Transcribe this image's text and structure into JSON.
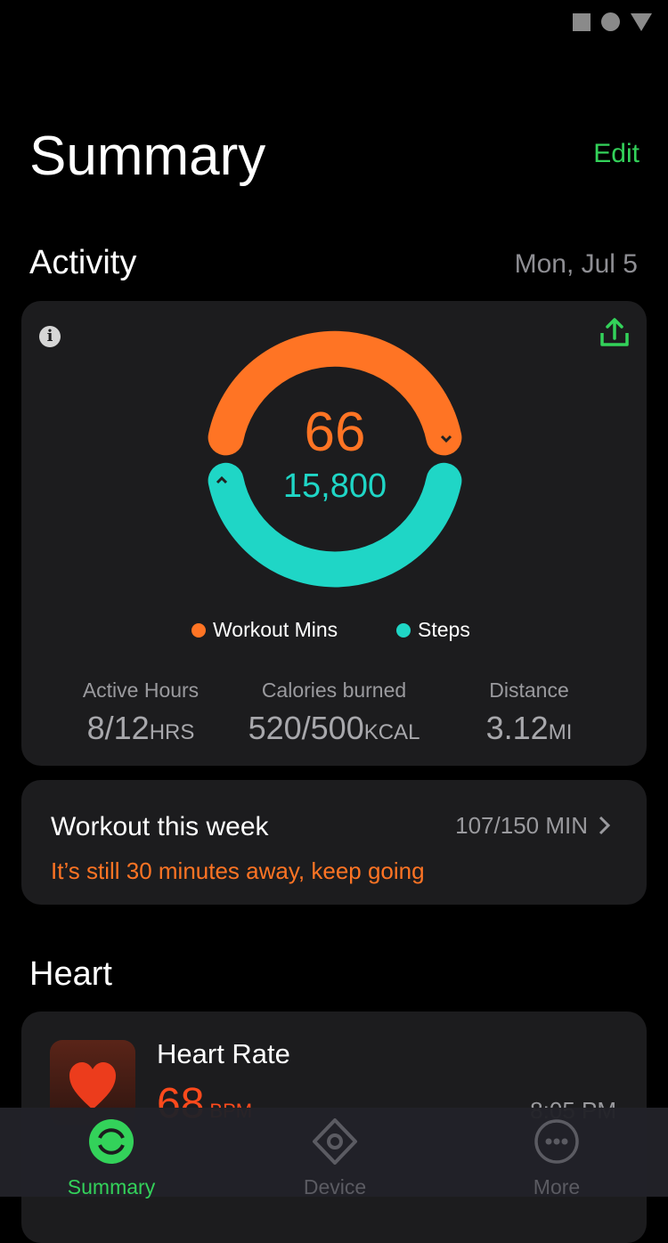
{
  "header": {
    "title": "Summary",
    "edit_label": "Edit"
  },
  "activity": {
    "section_title": "Activity",
    "date": "Mon, Jul 5",
    "workout_mins": "66",
    "steps": "15,800",
    "legend": [
      {
        "label": "Workout Mins",
        "color": "#ff7424"
      },
      {
        "label": "Steps",
        "color": "#1fd6c6"
      }
    ],
    "stats": [
      {
        "label": "Active Hours",
        "value": "8/12",
        "unit": "HRS"
      },
      {
        "label": "Calories burned",
        "value": "520/500",
        "unit": "KCAL"
      },
      {
        "label": "Distance",
        "value": "3.12",
        "unit": "MI"
      }
    ]
  },
  "workout_week": {
    "title": "Workout this week",
    "value": "107/150 MIN",
    "message": "It’s still 30 minutes away, keep going"
  },
  "heart": {
    "section_title": "Heart",
    "card_title": "Heart Rate",
    "value": "68",
    "unit": "BPM",
    "time": "8:05 PM"
  },
  "nav": {
    "items": [
      {
        "label": "Summary",
        "icon": "summary-icon",
        "active": true
      },
      {
        "label": "Device",
        "icon": "device-icon"
      },
      {
        "label": "More",
        "icon": "more-icon"
      }
    ]
  },
  "colors": {
    "accent": "#33d25a",
    "orange": "#ff7424",
    "teal": "#1fd6c6"
  }
}
